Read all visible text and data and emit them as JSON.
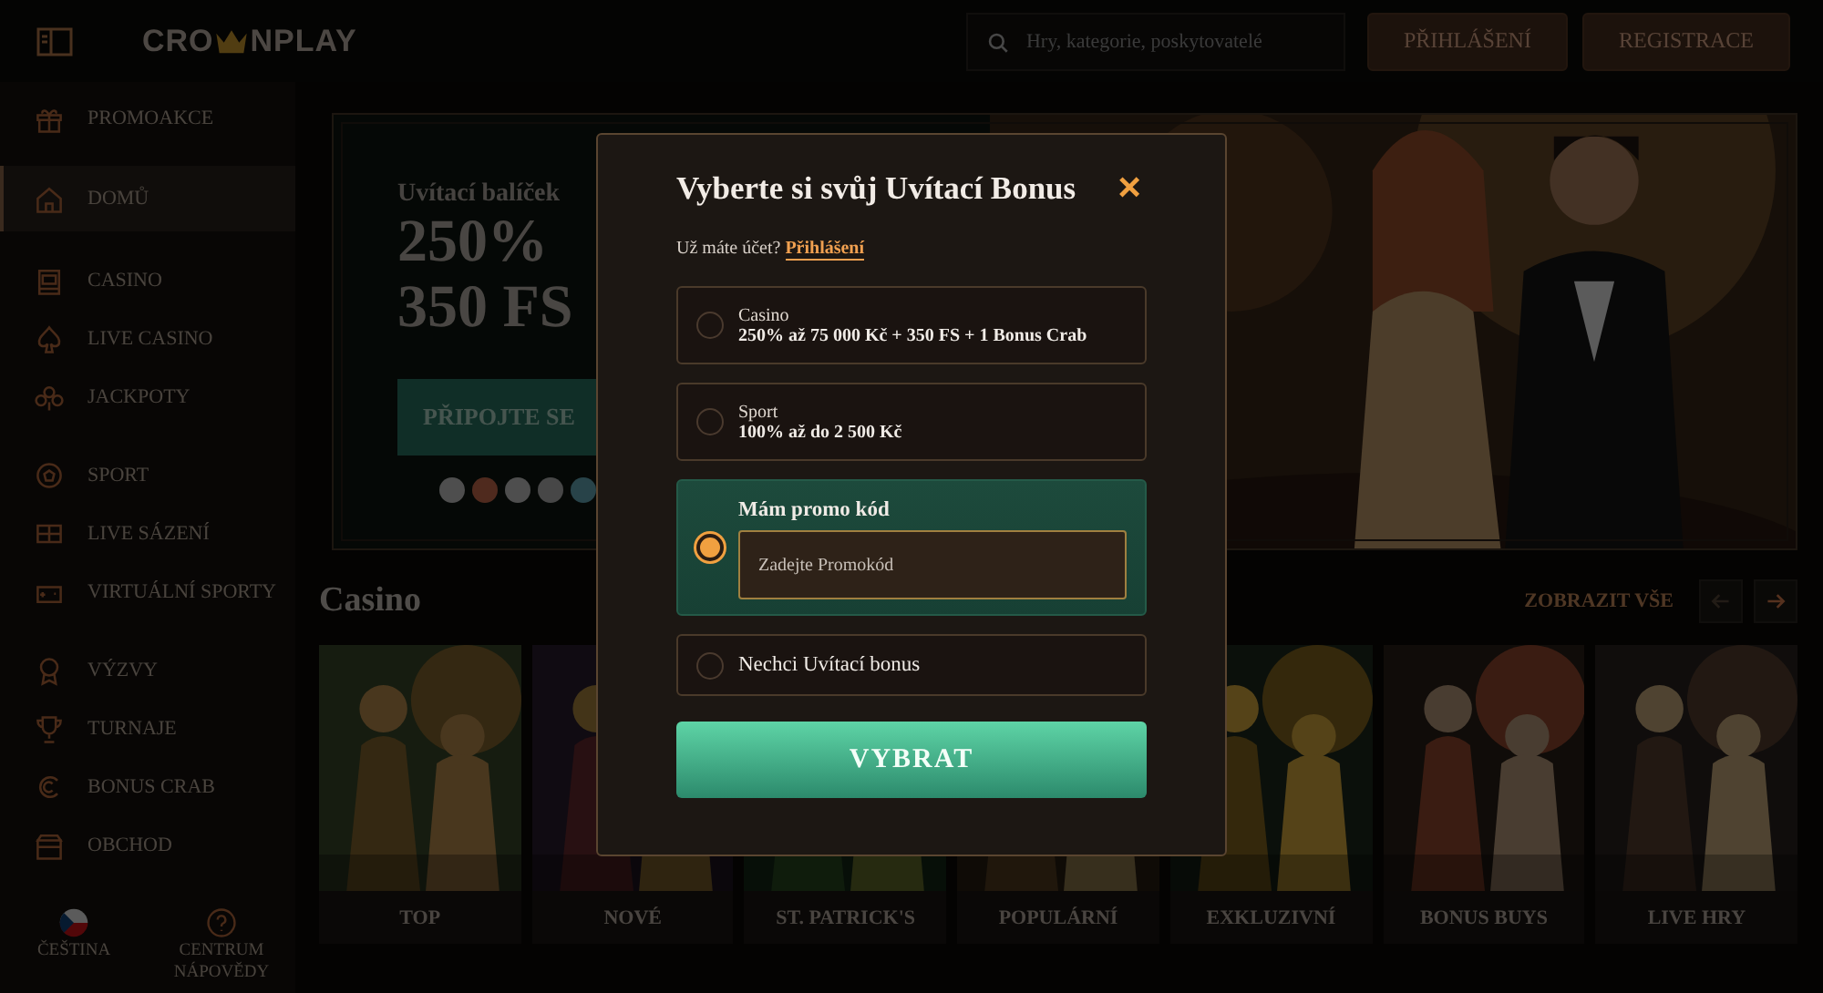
{
  "header": {
    "logo": {
      "left": "CRO",
      "right": "NPLAY"
    },
    "search": {
      "placeholder": "Hry, kategorie, poskytovatelé"
    },
    "buttons": [
      "PŘIHLÁŠENÍ",
      "REGISTRACE"
    ]
  },
  "sidebar": {
    "groups": [
      {
        "items": [
          {
            "label": "PROMOAKCE",
            "selected": false
          },
          {
            "label": "DOMŮ",
            "selected": true
          }
        ]
      },
      {
        "items": [
          {
            "label": "CASINO",
            "selected": false
          },
          {
            "label": "LIVE CASINO",
            "selected": false
          },
          {
            "label": "JACKPOTY",
            "selected": false
          }
        ]
      },
      {
        "items": [
          {
            "label": "SPORT",
            "selected": false
          },
          {
            "label": "LIVE SÁZENÍ",
            "selected": false
          },
          {
            "label": "VIRTUÁLNÍ SPORTY",
            "selected": false
          }
        ]
      },
      {
        "items": [
          {
            "label": "VÝZVY",
            "selected": false
          },
          {
            "label": "TURNAJE",
            "selected": false
          },
          {
            "label": "BONUS CRAB",
            "selected": false
          },
          {
            "label": "OBCHOD",
            "selected": false
          }
        ]
      }
    ],
    "footer": {
      "language": "ČEŠTINA",
      "help": "CENTRUM NÁPOVĚDY"
    }
  },
  "hero": {
    "eyebrow": "Uvítací balíček",
    "headline": [
      "250%",
      "350 FS"
    ],
    "button": "PŘIPOJTE SE"
  },
  "casino": {
    "title": "Casino",
    "view_all": "ZOBRAZIT VŠE",
    "prev_disabled": true,
    "next_disabled": false,
    "tiles": [
      {
        "label": "TOP",
        "kind": "picture"
      },
      {
        "label": "NOVÉ",
        "kind": "picture"
      },
      {
        "label": "ST. PATRICK'S",
        "kind": "picture"
      },
      {
        "label": "POPULÁRNÍ",
        "kind": "picture"
      },
      {
        "label": "EXKLUZIVNÍ",
        "kind": "picture"
      },
      {
        "label": "BONUS BUYS",
        "kind": "picture"
      },
      {
        "label": "LIVE HRY",
        "kind": "picture"
      }
    ]
  },
  "modal": {
    "title": "Vyberte si svůj Uvítací Bonus",
    "close": "×",
    "account_prompt": "Už máte účet?",
    "login_link": "Přihlášení",
    "options": [
      {
        "kind": "offer",
        "category": "Casino",
        "text": "250% až 75 000 Kč + 350 FS + 1 Bonus Crab",
        "selected": false
      },
      {
        "kind": "offer",
        "category": "Sport",
        "text": "100% až do 2 500 Kč",
        "selected": false
      },
      {
        "kind": "promo",
        "text": "Mám promo kód",
        "placeholder": "Zadejte Promokód",
        "selected": true
      },
      {
        "kind": "plain",
        "text": "Nechci Uvítací bonus",
        "selected": false
      }
    ],
    "submit": "VYBRAT"
  }
}
